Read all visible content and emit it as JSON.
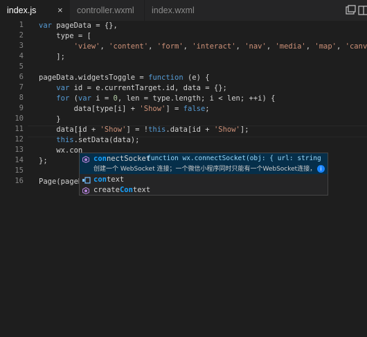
{
  "tabs": [
    {
      "label": "index.js",
      "active": true,
      "close": "×"
    },
    {
      "label": "controller.wxml",
      "active": false
    },
    {
      "label": "index.wxml",
      "active": false
    }
  ],
  "toolbar_icons": [
    "split-editor-icon",
    "more-actions-icon"
  ],
  "line_numbers": [
    "1",
    "2",
    "3",
    "4",
    "5",
    "6",
    "7",
    "8",
    "9",
    "10",
    "11",
    "12",
    "13",
    "14",
    "15",
    "16"
  ],
  "code": {
    "l1": {
      "a": "var",
      "b": " pageData ",
      "c": "= {},"
    },
    "l2": {
      "a": "    type ",
      "b": "= ["
    },
    "l3": {
      "a": "        ",
      "s1": "'view'",
      "c1": ", ",
      "s2": "'content'",
      "c2": ", ",
      "s3": "'form'",
      "c3": ", ",
      "s4": "'interact'",
      "c4": ", ",
      "s5": "'nav'",
      "c5": ", ",
      "s6": "'media'",
      "c6": ", ",
      "s7": "'map'",
      "c7": ", ",
      "s8": "'canvas'"
    },
    "l4": {
      "a": "    ];"
    },
    "l6": {
      "a": "pageData.widgetsToggle ",
      "b": "= ",
      "c": "function",
      "d": " (e) {"
    },
    "l7": {
      "a": "    ",
      "b": "var",
      "c": " id ",
      "d": "= e.currentTarget.id, data ",
      "e": "= {};"
    },
    "l8": {
      "a": "    ",
      "b": "for",
      "c": " (",
      "d": "var",
      "e": " i ",
      "f": "= ",
      "g": "0",
      "h": ", len ",
      "i": "= type.length; i ",
      "j": "< len; ++i) {"
    },
    "l9": {
      "a": "        data[type[i] ",
      "b": "+ ",
      "c": "'Show'",
      "d": "] ",
      "e": "= ",
      "f": "false",
      "g": ";"
    },
    "l10": {
      "a": "    }"
    },
    "l11": {
      "a": "    data[id ",
      "b": "+ ",
      "c": "'Show'",
      "d": "] ",
      "e": "= !",
      "f": "this",
      "g": ".data[id ",
      "h": "+ ",
      "i": "'Show'",
      "j": "];"
    },
    "l12": {
      "a": "    ",
      "b": "this",
      "c": ".setData(data);"
    },
    "l13": {
      "a": "    wx.con"
    },
    "l14": {
      "a": "};"
    },
    "l16": {
      "a": "Page(pageD"
    }
  },
  "suggest": {
    "items": [
      {
        "match": "con",
        "rest": "nectSocket",
        "icon": "method-icon",
        "detail": "function wx.connectSocket(obj: { url: string; data?…",
        "doc": "创建一个 WebSocket 连接；一个微信小程序同时只能有一个WebSocket连接，…",
        "info": "i"
      },
      {
        "match": "con",
        "rest": "text",
        "icon": "snippet-icon"
      },
      {
        "pre": "create",
        "match": "Con",
        "rest": "text",
        "icon": "method-icon"
      }
    ]
  },
  "colors": {
    "background": "#1e1e1e",
    "keyword": "#569cd6",
    "string": "#ce9178",
    "number": "#b5cea8",
    "match_highlight": "#18a3ff",
    "selection": "#062f4a"
  }
}
